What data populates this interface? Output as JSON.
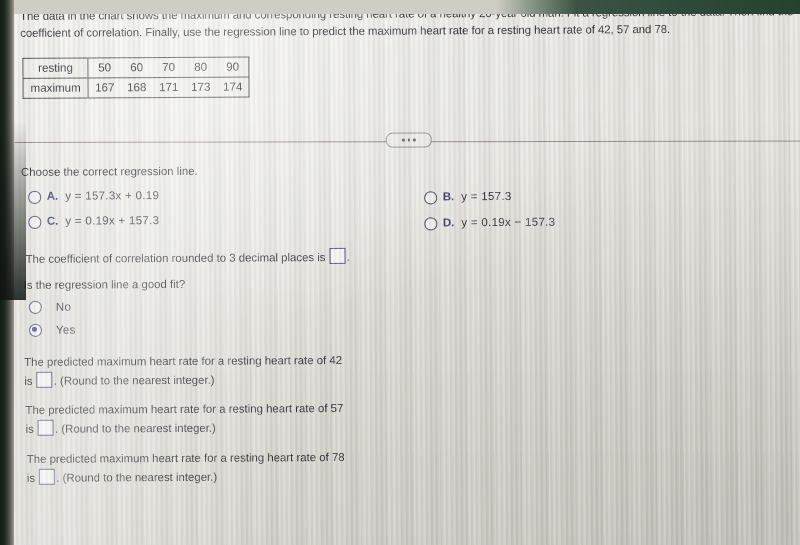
{
  "problem": {
    "prompt": "The data in the chart shows the maximum and corresponding resting heart rate of a healthy 20-year old man. Fit a regression line to the data. Then find the coefficient of correlation. Finally, use the regression line to predict the maximum heart rate for a resting heart rate of 42, 57 and 78.",
    "table": {
      "row_labels": [
        "resting",
        "maximum"
      ],
      "resting": [
        "50",
        "60",
        "70",
        "80",
        "90"
      ],
      "maximum": [
        "167",
        "168",
        "171",
        "173",
        "174"
      ]
    }
  },
  "divider": {
    "ellipsis_dots": [
      "",
      "",
      ""
    ]
  },
  "regression_question": {
    "text": "Choose the correct regression line.",
    "options": [
      {
        "letter": "A.",
        "equation": "y = 157.3x + 0.19",
        "selected": false
      },
      {
        "letter": "B.",
        "equation": "y = 157.3",
        "selected": false
      },
      {
        "letter": "C.",
        "equation": "y = 0.19x + 157.3",
        "selected": false
      },
      {
        "letter": "D.",
        "equation": "y = 0.19x − 157.3",
        "selected": false
      }
    ]
  },
  "correlation": {
    "text_before": "The coefficient of correlation rounded to 3 decimal places is",
    "value": "",
    "text_after": "."
  },
  "goodfit": {
    "question": "Is the regression line a good fit?",
    "options": [
      {
        "label": "No",
        "selected": false
      },
      {
        "label": "Yes",
        "selected": true
      }
    ]
  },
  "predictions": [
    {
      "line1": "The predicted maximum heart rate for a resting heart rate of 42",
      "is_label": "is",
      "value": "",
      "note": ". (Round to the nearest integer.)"
    },
    {
      "line1": "The predicted maximum heart rate for a resting heart rate of 57",
      "is_label": "is",
      "value": "",
      "note": ". (Round to the nearest integer.)"
    },
    {
      "line1": "The predicted maximum heart rate for a resting heart rate of 78",
      "is_label": "is",
      "value": "",
      "note": ". (Round to the nearest integer.)"
    }
  ],
  "colors": {
    "accent_blue": "#2b3a8f",
    "option_label": "#242a5e",
    "text": "#14141c",
    "screen_bg": "#e2e1db",
    "bezel_green": "#2f4a3b"
  }
}
